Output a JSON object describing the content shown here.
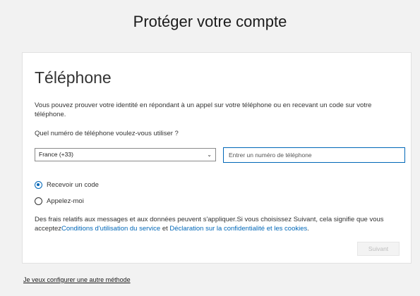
{
  "header": {
    "title": "Protéger votre compte"
  },
  "card": {
    "title": "Téléphone",
    "description": "Vous pouvez prouver votre identité en répondant à un appel sur votre téléphone ou en recevant un code sur votre téléphone.",
    "question": "Quel numéro de téléphone voulez-vous utiliser ?",
    "country_select": {
      "selected": "France (+33)"
    },
    "phone_input": {
      "value": "",
      "placeholder": "Entrer un numéro de téléphone"
    },
    "options": [
      {
        "label": "Recevoir un code",
        "checked": true
      },
      {
        "label": "Appelez-moi",
        "checked": false
      }
    ],
    "fees_text_1": "Des frais relatifs aux messages et aux données peuvent s'appliquer.Si vous choisissez Suivant, cela signifie que vous acceptez",
    "terms_link": "Conditions d'utilisation du service",
    "fees_and": " et ",
    "privacy_link": "Déclaration sur la confidentialité et les cookies",
    "fees_end": ".",
    "next_label": "Suivant"
  },
  "footer": {
    "other_method_link": "Je veux configurer une autre méthode"
  },
  "colors": {
    "accent": "#0067b8",
    "background": "#f2f2f2",
    "disabled_text": "#bdbdbd"
  }
}
